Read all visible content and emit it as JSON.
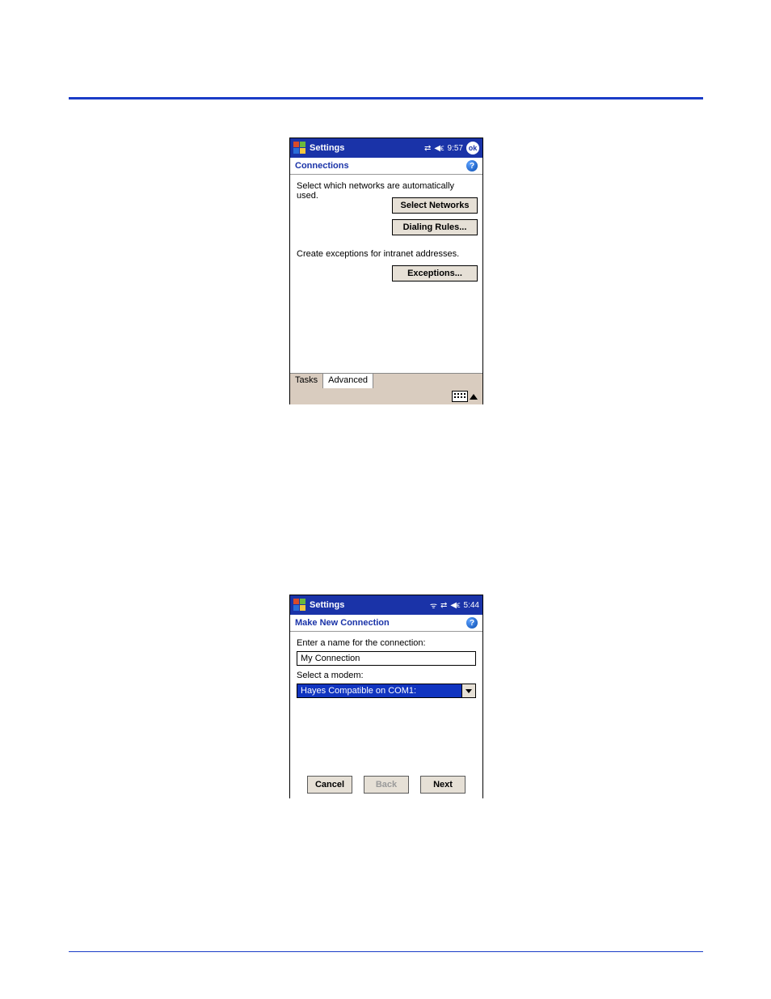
{
  "screen1": {
    "titlebar": {
      "app_title": "Settings",
      "time": "9:57",
      "ok_label": "ok"
    },
    "subheader": {
      "title": "Connections",
      "help_glyph": "?"
    },
    "body": {
      "text_networks": "Select which networks are automatically used.",
      "btn_select_networks": "Select Networks",
      "btn_dialing_rules": "Dialing Rules...",
      "text_exceptions": "Create exceptions for intranet addresses.",
      "btn_exceptions": "Exceptions..."
    },
    "tabs": {
      "tasks": "Tasks",
      "advanced": "Advanced"
    }
  },
  "screen2": {
    "titlebar": {
      "app_title": "Settings",
      "time": "5:44"
    },
    "subheader": {
      "title": "Make New Connection",
      "help_glyph": "?"
    },
    "body": {
      "label_name": "Enter a name for the connection:",
      "value_name": "My Connection",
      "label_modem": "Select a modem:",
      "value_modem": "Hayes Compatible on COM1:"
    },
    "buttons": {
      "cancel": "Cancel",
      "back": "Back",
      "next": "Next"
    }
  }
}
